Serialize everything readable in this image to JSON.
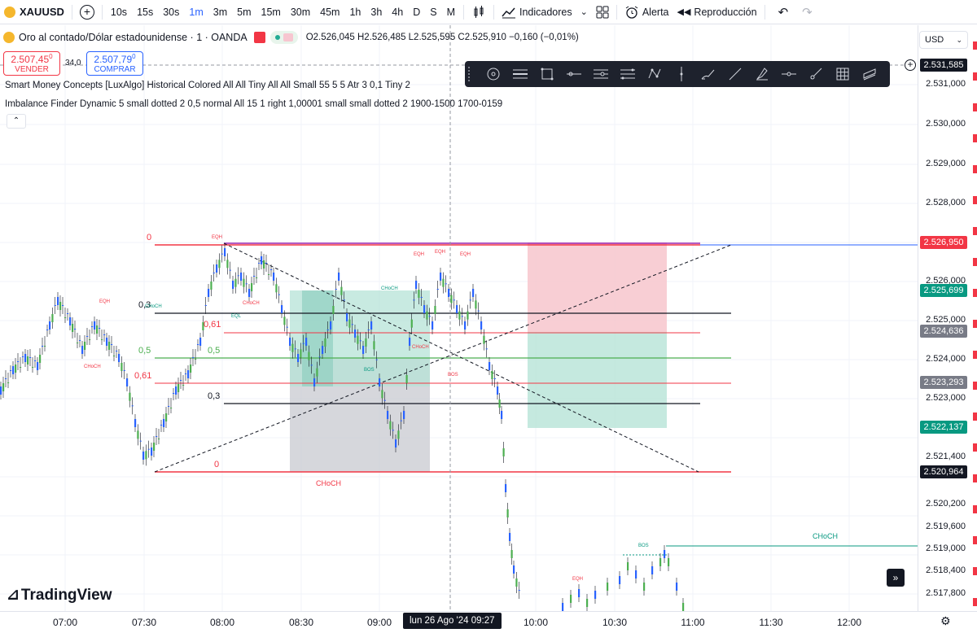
{
  "toolbar": {
    "symbol": "XAUUSD",
    "add_symbol": "+",
    "timeframes": [
      "10s",
      "15s",
      "30s",
      "1m",
      "3m",
      "5m",
      "15m",
      "30m",
      "45m",
      "1h",
      "3h",
      "4h",
      "D",
      "S",
      "M"
    ],
    "active_timeframe": "1m",
    "indicators_label": "Indicadores",
    "alert_label": "Alerta",
    "replay_label": "Reproducción"
  },
  "legend": {
    "title": "Oro al contado/Dólar estadounidense · 1 · OANDA",
    "ohlc": "O2.526,045 H2.526,485 L2.525,595 C2.525,910 −0,160 (−0,01%)",
    "sell_price": "2.507,45",
    "sell_price_sup": "0",
    "sell_label": "VENDER",
    "spread": "34,0",
    "buy_price": "2.507,79",
    "buy_price_sup": "0",
    "buy_label": "COMPRAR"
  },
  "indicators": [
    "Smart Money Concepts [LuxAlgo] Historical Colored All All Tiny All All Small 55 5 5 Atr 3 0,1 Tiny 2",
    "Imbalance Finder Dynamic 5 small dotted 2 0,5 normal All 15 1 right 1,00001 small small dotted 2 1900-1500 1700-0159"
  ],
  "price_axis": {
    "currency": "USD",
    "labels": [
      "2.531,000",
      "2.530,000",
      "2.529,000",
      "2.528,000",
      "2.526,000",
      "2.525,000",
      "2.524,000",
      "2.523,000",
      "2.521,400",
      "2.520,200",
      "2.519,600",
      "2.519,000",
      "2.518,400",
      "2.517,800"
    ],
    "tags": [
      {
        "value": "2.531,585",
        "color": "#131722"
      },
      {
        "value": "2.526,950",
        "color": "#f23645"
      },
      {
        "value": "2.525,699",
        "color": "#089981"
      },
      {
        "value": "2.524,636",
        "color": "#787b86"
      },
      {
        "value": "2.523,293",
        "color": "#787b86"
      },
      {
        "value": "2.522,137",
        "color": "#089981"
      },
      {
        "value": "2.520,964",
        "color": "#131722"
      }
    ]
  },
  "time_axis": {
    "labels": [
      "07:00",
      "07:30",
      "08:00",
      "08:30",
      "09:00",
      "10:00",
      "10:30",
      "11:00",
      "11:30",
      "12:00"
    ],
    "current": "lun 26 Ago '24   09:27"
  },
  "fib": {
    "top_zero": "0",
    "level_03_top": "0,3",
    "level_061_top": "0,61",
    "level_05_left": "0,5",
    "level_05_right": "0,5",
    "level_061_bot": "0,61",
    "level_03_bot": "0,3",
    "bottom_zero": "0"
  },
  "smc_labels": {
    "choch_bottom": "CHoCH",
    "choch_right": "CHoCH",
    "eqh_left": "EQH",
    "choch_small1": "CHoCH",
    "choch_small2": "CHoCH",
    "eql": "EQL",
    "eqh_mid1": "EQH",
    "eqh_mid2": "EQH",
    "eqh_mid3": "EQH",
    "choch_mid": "CHoCH",
    "bos_mid": "BOS",
    "bos_mid2": "BOS",
    "choch_mid2": "CHoCH",
    "eqh_top": "EQH",
    "bos_right": "BOS",
    "eqh_right": "EQH",
    "choch_right2": "CHoCH"
  },
  "branding": {
    "logo_text": "TradingView"
  },
  "colors": {
    "bull": "#4caf50",
    "bear": "#2962ff",
    "fib_red": "#f23645",
    "fib_green": "#4caf50",
    "sell_zone": "#f7c6cc",
    "buy_zone": "#b6e3d7"
  }
}
